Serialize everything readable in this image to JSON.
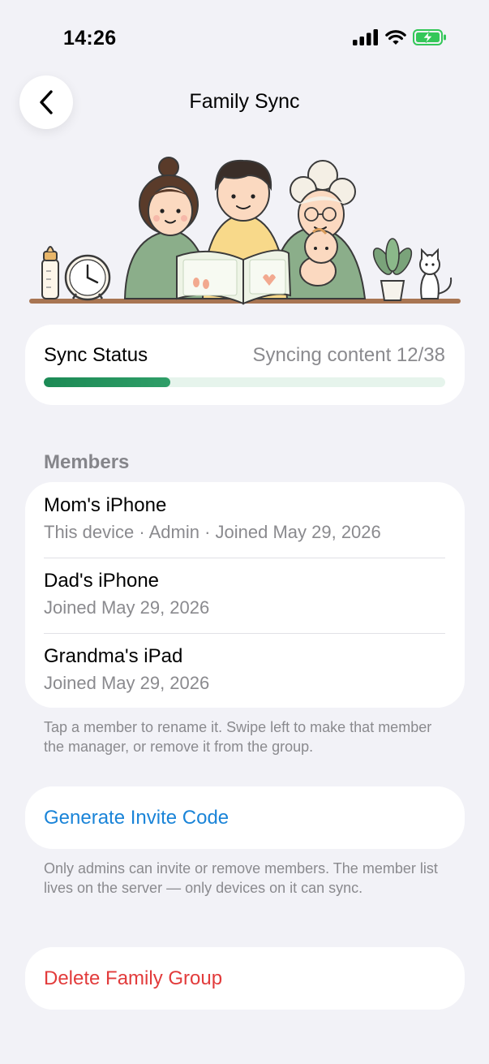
{
  "status_bar": {
    "time": "14:26",
    "icons": [
      "signal-icon",
      "wifi-icon",
      "battery-charging-icon"
    ],
    "battery_color": "#34c759"
  },
  "nav": {
    "back_icon": "chevron-left-icon",
    "title": "Family Sync"
  },
  "hero": {
    "illustration": "family-reading-book-illustration"
  },
  "sync": {
    "label": "Sync Status",
    "status_text": "Syncing content 12/38",
    "progress": 0.316,
    "accent_color": "#1c8a55"
  },
  "members": {
    "header": "Members",
    "items": [
      {
        "name": "Mom's iPhone",
        "detail": "This device · Admin · Joined May 29, 2026"
      },
      {
        "name": "Dad's iPhone",
        "detail": "Joined May 29, 2026"
      },
      {
        "name": "Grandma's iPad",
        "detail": "Joined May 29, 2026"
      }
    ],
    "footnote": "Tap a member to rename it. Swipe left to make that member the manager, or remove it from the group."
  },
  "invite": {
    "label": "Generate Invite Code",
    "color": "#1a84d8",
    "footnote": "Only admins can invite or remove members. The member list lives on the server — only devices on it can sync."
  },
  "delete": {
    "label": "Delete Family Group",
    "color": "#e23b3b"
  }
}
